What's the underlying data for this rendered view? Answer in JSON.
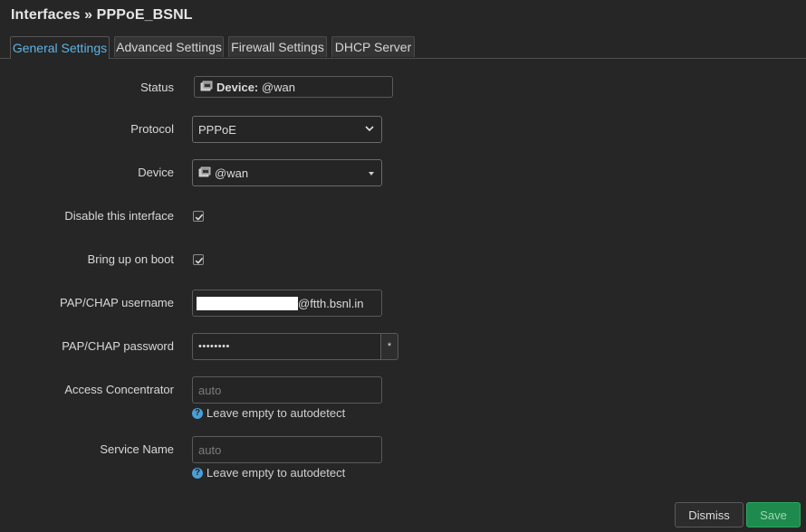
{
  "page": {
    "title": "Interfaces » PPPoE_BSNL"
  },
  "tabs": [
    {
      "label": "General Settings",
      "active": true
    },
    {
      "label": "Advanced Settings",
      "active": false
    },
    {
      "label": "Firewall Settings",
      "active": false
    },
    {
      "label": "DHCP Server",
      "active": false
    }
  ],
  "form": {
    "status": {
      "label": "Status",
      "device_prefix": "Device:",
      "device_value": "@wan"
    },
    "protocol": {
      "label": "Protocol",
      "value": "PPPoE"
    },
    "device": {
      "label": "Device",
      "value": "@wan"
    },
    "disable_interface": {
      "label": "Disable this interface",
      "checked": true
    },
    "bring_up_on_boot": {
      "label": "Bring up on boot",
      "checked": true
    },
    "username": {
      "label": "PAP/CHAP username",
      "value_suffix": "@ftth.bsnl.in"
    },
    "password": {
      "label": "PAP/CHAP password",
      "value": "••••••••",
      "reveal_label": "*"
    },
    "access_concentrator": {
      "label": "Access Concentrator",
      "placeholder": "auto",
      "help": "Leave empty to autodetect"
    },
    "service_name": {
      "label": "Service Name",
      "placeholder": "auto",
      "help": "Leave empty to autodetect"
    }
  },
  "actions": {
    "dismiss_label": "Dismiss",
    "save_label": "Save"
  },
  "colors": {
    "background": "#262626",
    "accent_tab": "#5fb3e6",
    "save_button": "#1f8a4e",
    "help_icon": "#4a9fd8"
  }
}
